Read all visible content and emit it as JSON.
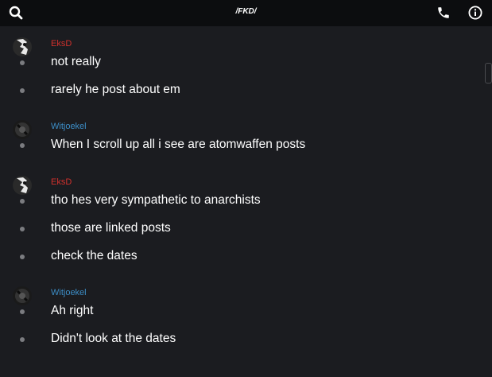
{
  "header": {
    "title": "/FKD/",
    "icons": [
      "search-icon",
      "phone-icon",
      "info-icon"
    ]
  },
  "colors": {
    "eksd": "#d0312d",
    "witjoekel": "#3c8dc6"
  },
  "groups": [
    {
      "user": "EksD",
      "messages": [
        "not really",
        "rarely he post about em"
      ]
    },
    {
      "user": "Witjoekel",
      "messages": [
        "When I scroll up all i see are atomwaffen posts"
      ]
    },
    {
      "user": "EksD",
      "messages": [
        "tho hes very sympathetic to anarchists",
        "those are linked posts",
        "check the dates"
      ]
    },
    {
      "user": "Witjoekel",
      "messages": [
        "Ah right",
        "Didn't look at the dates"
      ]
    }
  ]
}
